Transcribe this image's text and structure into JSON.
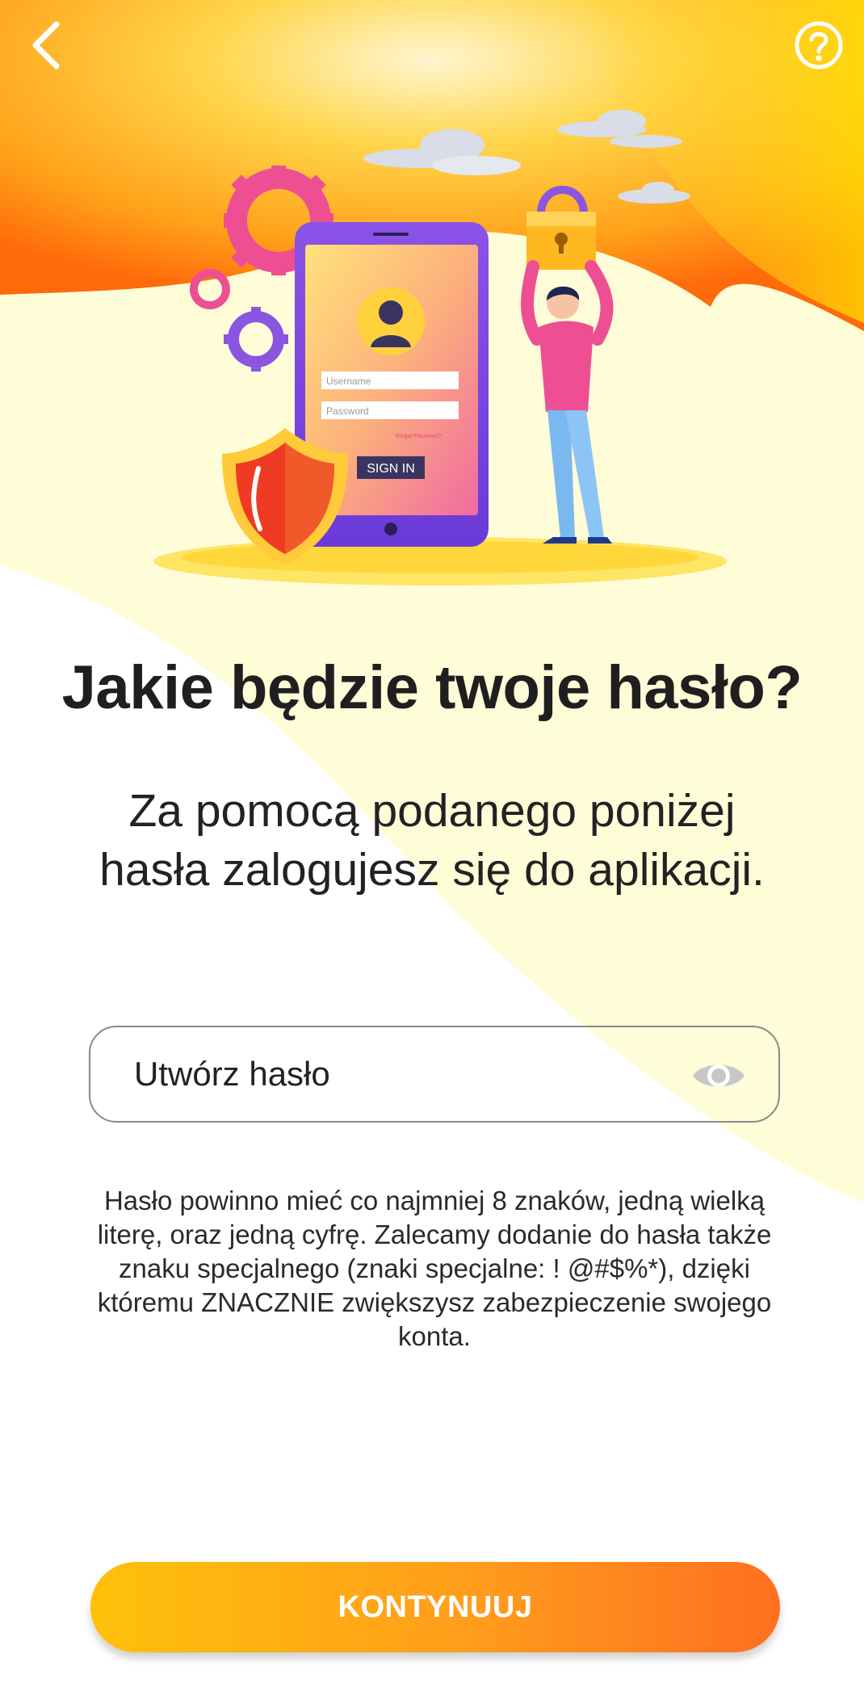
{
  "header": {
    "back_icon": "chevron-left-icon",
    "help_icon": "question-circle-icon"
  },
  "illustration": {
    "username_placeholder": "Username",
    "password_placeholder": "Password",
    "forgot_text": "Forgot Password?",
    "signin_label": "SIGN IN"
  },
  "main": {
    "title": "Jakie będzie twoje hasło?",
    "subtitle": "Za pomocą podanego poniżej hasła zalogujesz się do aplikacji.",
    "password_placeholder": "Utwórz hasło",
    "eye_icon": "eye-icon",
    "hint": "Hasło powinno mieć co najmniej 8 znaków, jedną wielką literę, oraz jedną cyfrę. Zalecamy dodanie do hasła także znaku specjalnego (znaki specjalne: ! @#$%*), dzięki któremu ZNACZNIE zwiększysz zabezpieczenie swojego konta.",
    "continue_label": "KONTYNUUJ"
  },
  "colors": {
    "accent_orange": "#ff6f20",
    "accent_yellow": "#ffc10a",
    "text_dark": "#1f1f1f"
  }
}
